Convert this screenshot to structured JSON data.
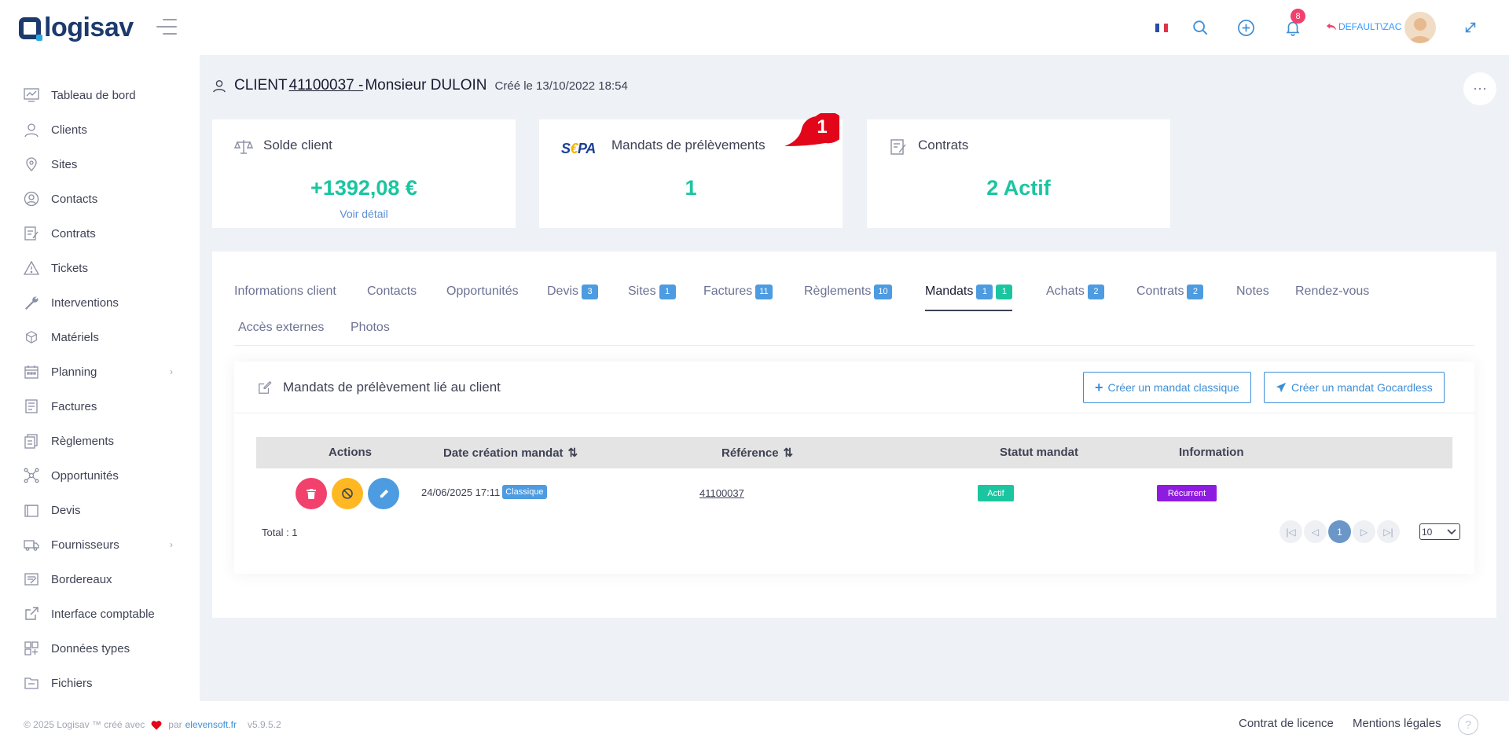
{
  "header": {
    "logo": "logisav",
    "notifications_count": "8",
    "user": "DEFAULT\\ZAC"
  },
  "sidebar": {
    "items": [
      {
        "label": "Tableau de bord",
        "icon": "dashboard-icon"
      },
      {
        "label": "Clients",
        "icon": "user-icon"
      },
      {
        "label": "Sites",
        "icon": "location-pin-icon"
      },
      {
        "label": "Contacts",
        "icon": "contacts-icon"
      },
      {
        "label": "Contrats",
        "icon": "contract-icon"
      },
      {
        "label": "Tickets",
        "icon": "warning-icon"
      },
      {
        "label": "Interventions",
        "icon": "wrench-icon"
      },
      {
        "label": "Matériels",
        "icon": "box-icon"
      },
      {
        "label": "Planning",
        "icon": "calendar-icon"
      },
      {
        "label": "Factures",
        "icon": "invoice-icon"
      },
      {
        "label": "Règlements",
        "icon": "payment-icon"
      },
      {
        "label": "Opportunités",
        "icon": "network-icon"
      },
      {
        "label": "Devis",
        "icon": "quote-icon"
      },
      {
        "label": "Fournisseurs",
        "icon": "truck-icon"
      },
      {
        "label": "Bordereaux",
        "icon": "slip-icon"
      },
      {
        "label": "Interface comptable",
        "icon": "external-link-icon"
      },
      {
        "label": "Données types",
        "icon": "grid-icon"
      },
      {
        "label": "Fichiers",
        "icon": "folder-icon"
      }
    ]
  },
  "page": {
    "title_prefix": "CLIENT",
    "client_number": " 41100037 - ",
    "client_name": "Monsieur DULOIN",
    "created": "Créé le 13/10/2022 18:54"
  },
  "cards": {
    "balance": {
      "title": "Solde client",
      "value": "+1392,08 €",
      "link": "Voir détail"
    },
    "mandates": {
      "logo": "SEPA",
      "title": "Mandats de prélèvements",
      "value": "1",
      "bubble": "1"
    },
    "contracts": {
      "title": "Contrats",
      "value": "2 Actif"
    }
  },
  "tabs": [
    {
      "label": "Informations client"
    },
    {
      "label": "Contacts"
    },
    {
      "label": "Opportunités"
    },
    {
      "label": "Devis",
      "badge": "3"
    },
    {
      "label": "Sites",
      "badge": "1"
    },
    {
      "label": "Factures",
      "badge": "11"
    },
    {
      "label": "Règlements",
      "badge": "10"
    },
    {
      "label": "Mandats",
      "badge": "1",
      "badge2": "1"
    },
    {
      "label": "Achats",
      "badge": "2"
    },
    {
      "label": "Contrats",
      "badge": "2"
    },
    {
      "label": "Notes"
    },
    {
      "label": "Rendez-vous"
    },
    {
      "label": "Accès externes"
    },
    {
      "label": "Photos"
    }
  ],
  "mandates_section": {
    "title": "Mandats de prélèvement lié au client",
    "btn_classic": "Créer un mandat classique",
    "btn_gocardless": "Créer un mandat Gocardless",
    "columns": [
      "Actions",
      "Date création mandat",
      "Référence",
      "Statut mandat",
      "Information"
    ],
    "rows": [
      {
        "date": "24/06/2025 17:11",
        "type": "Classique",
        "reference": "41100037",
        "status": "Actif",
        "info": "Récurrent"
      }
    ],
    "total": "Total : 1",
    "current_page": "1",
    "per_page": "10"
  },
  "colors": {
    "accent": "#3d8ed6",
    "success": "#1bc5a0",
    "danger": "#f1416c",
    "warning": "#ffb822",
    "purple": "#8e1be0"
  },
  "footer": {
    "copyright": "© 2025 Logisav ™ créé avec",
    "by": "par",
    "company": "elevensoft.fr",
    "version": "v5.9.5.2",
    "license": "Contrat de licence",
    "legal": "Mentions légales"
  }
}
